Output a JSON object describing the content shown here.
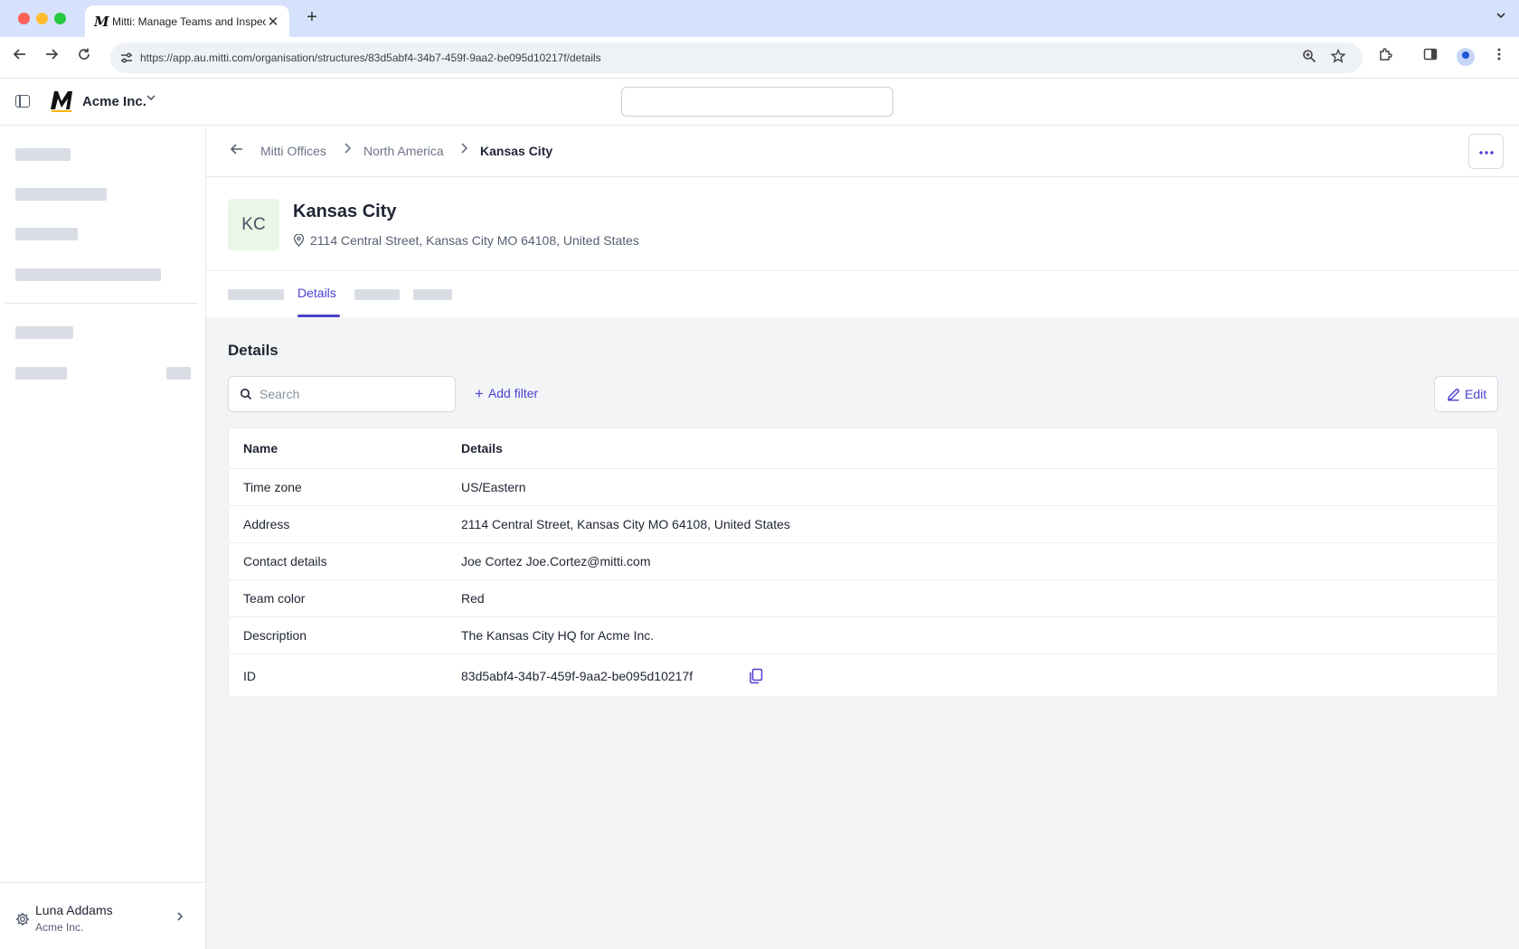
{
  "browser": {
    "tab_title": "Mitti: Manage Teams and Inspect...",
    "tab_favicon": "M",
    "url": "https://app.au.mitti.com/organisation/structures/83d5abf4-34b7-459f-9aa2-be095d10217f/details"
  },
  "header": {
    "org_name": "Acme Inc.",
    "logo_icon": "mitti-logo-icon"
  },
  "sidebar": {
    "user_name": "Luna Addams",
    "user_org": "Acme Inc."
  },
  "breadcrumb": {
    "items": [
      "Mitti Offices",
      "North America",
      "Kansas City"
    ]
  },
  "page": {
    "avatar_initials": "KC",
    "title": "Kansas City",
    "address": "2114 Central Street, Kansas City MO 64108, United States"
  },
  "tabs": {
    "active_label": "Details"
  },
  "section": {
    "title": "Details",
    "search_placeholder": "Search",
    "add_filter_label": "Add filter",
    "edit_label": "Edit"
  },
  "table": {
    "headers": [
      "Name",
      "Details"
    ],
    "rows": [
      {
        "name": "Time zone",
        "value": "US/Eastern"
      },
      {
        "name": "Address",
        "value": "2114 Central Street, Kansas City MO 64108, United States"
      },
      {
        "name": "Contact details",
        "value": "Joe Cortez Joe.Cortez@mitti.com"
      },
      {
        "name": "Team color",
        "value": "Red"
      },
      {
        "name": "Description",
        "value": "The Kansas City HQ for Acme Inc."
      },
      {
        "name": "ID",
        "value": "83d5abf4-34b7-459f-9aa2-be095d10217f"
      }
    ]
  },
  "colors": {
    "accent": "#4b3fce",
    "avatar_bg": "#e9f7e6",
    "main_bg": "#f3f4f6"
  }
}
